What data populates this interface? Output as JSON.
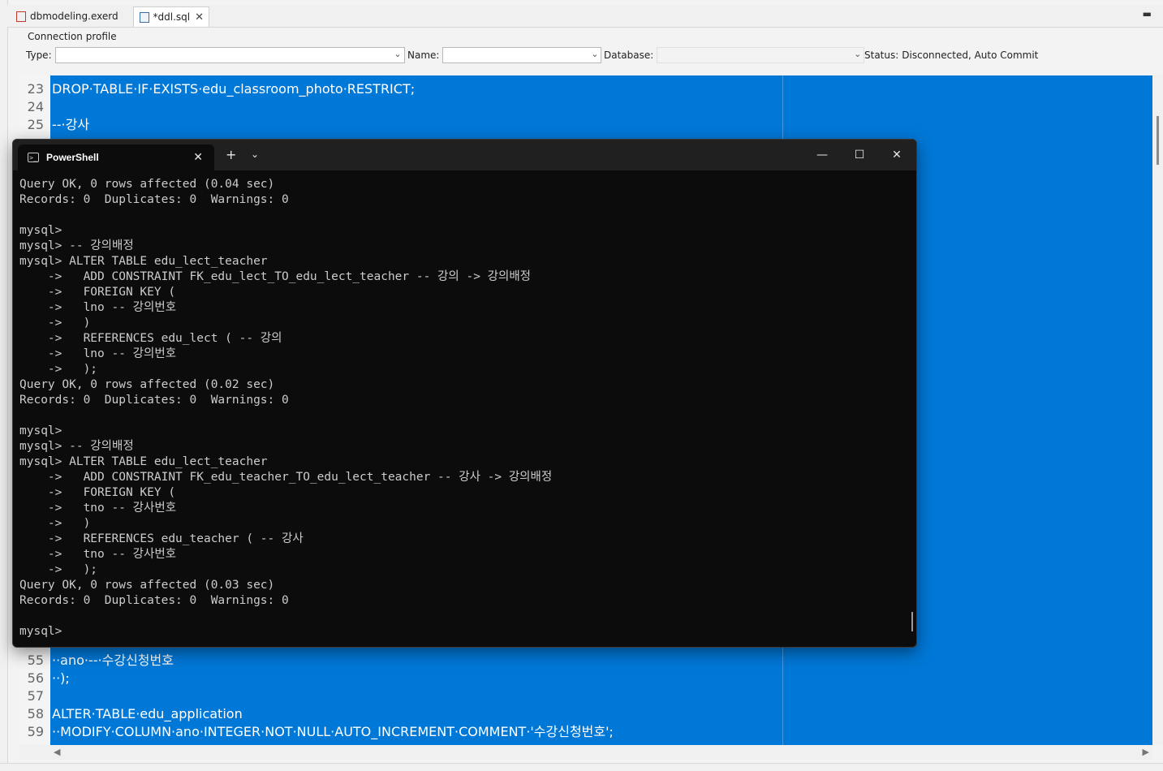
{
  "tabs": [
    {
      "label": "dbmodeling.exerd",
      "icon": "erd-file-icon",
      "active": false
    },
    {
      "label": "*ddl.sql",
      "icon": "sql-file-icon",
      "active": true
    }
  ],
  "connection_profile": {
    "title": "Connection profile",
    "type_label": "Type:",
    "type_value": "",
    "name_label": "Name:",
    "name_value": "",
    "database_label": "Database:",
    "database_value": "",
    "status_label": "Status:",
    "status_value": "Disconnected, Auto Commit"
  },
  "editor": {
    "lines_top": [
      {
        "n": "23",
        "text": "DROP·TABLE·IF·EXISTS·edu_classroom_photo·RESTRICT;"
      },
      {
        "n": "24",
        "text": ""
      },
      {
        "n": "25",
        "text": "--·강사"
      }
    ],
    "lines_bottom": [
      {
        "n": "55",
        "text": "··ano·--·수강신청번호"
      },
      {
        "n": "56",
        "text": "··);"
      },
      {
        "n": "57",
        "text": ""
      },
      {
        "n": "58",
        "text": "ALTER·TABLE·edu_application"
      },
      {
        "n": "59",
        "text": "··MODIFY·COLUMN·ano·INTEGER·NOT·NULL·AUTO_INCREMENT·COMMENT·'수강신청번호';"
      }
    ]
  },
  "terminal": {
    "tab_title": "PowerShell",
    "new_tab": "+",
    "dropdown": "⌄",
    "lines": [
      "Query OK, 0 rows affected (0.04 sec)",
      "Records: 0  Duplicates: 0  Warnings: 0",
      "",
      "mysql>",
      "mysql> -- 강의배정",
      "mysql> ALTER TABLE edu_lect_teacher",
      "    ->   ADD CONSTRAINT FK_edu_lect_TO_edu_lect_teacher -- 강의 -> 강의배정",
      "    ->   FOREIGN KEY (",
      "    ->   lno -- 강의번호",
      "    ->   )",
      "    ->   REFERENCES edu_lect ( -- 강의",
      "    ->   lno -- 강의번호",
      "    ->   );",
      "Query OK, 0 rows affected (0.02 sec)",
      "Records: 0  Duplicates: 0  Warnings: 0",
      "",
      "mysql>",
      "mysql> -- 강의배정",
      "mysql> ALTER TABLE edu_lect_teacher",
      "    ->   ADD CONSTRAINT FK_edu_teacher_TO_edu_lect_teacher -- 강사 -> 강의배정",
      "    ->   FOREIGN KEY (",
      "    ->   tno -- 강사번호",
      "    ->   )",
      "    ->   REFERENCES edu_teacher ( -- 강사",
      "    ->   tno -- 강사번호",
      "    ->   );",
      "Query OK, 0 rows affected (0.03 sec)",
      "Records: 0  Duplicates: 0  Warnings: 0",
      "",
      "mysql>"
    ]
  },
  "colors": {
    "selection": "#0078d7",
    "terminal_bg": "#0c0c0c",
    "terminal_fg": "#cccccc"
  }
}
